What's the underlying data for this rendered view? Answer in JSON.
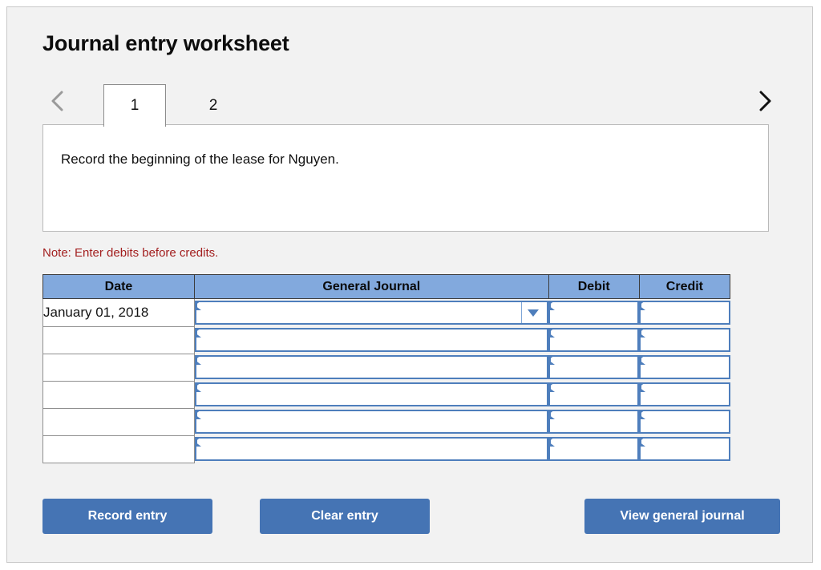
{
  "title": "Journal entry worksheet",
  "navigation": {
    "prev_icon": "chevron-left-icon",
    "next_icon": "chevron-right-icon",
    "tabs": [
      {
        "label": "1",
        "active": true
      },
      {
        "label": "2",
        "active": false
      }
    ]
  },
  "instruction": {
    "text": "Record the beginning of the lease for Nguyen."
  },
  "note": {
    "text": "Note: Enter debits before credits."
  },
  "table": {
    "headers": {
      "date": "Date",
      "general_journal": "General Journal",
      "debit": "Debit",
      "credit": "Credit"
    },
    "rows": [
      {
        "date": "January 01, 2018",
        "general_journal": "",
        "debit": "",
        "credit": "",
        "has_dropdown": true
      },
      {
        "date": "",
        "general_journal": "",
        "debit": "",
        "credit": "",
        "has_dropdown": false
      },
      {
        "date": "",
        "general_journal": "",
        "debit": "",
        "credit": "",
        "has_dropdown": false
      },
      {
        "date": "",
        "general_journal": "",
        "debit": "",
        "credit": "",
        "has_dropdown": false
      },
      {
        "date": "",
        "general_journal": "",
        "debit": "",
        "credit": "",
        "has_dropdown": false
      },
      {
        "date": "",
        "general_journal": "",
        "debit": "",
        "credit": "",
        "has_dropdown": false
      }
    ]
  },
  "buttons": {
    "record": "Record entry",
    "clear": "Clear entry",
    "view": "View general journal"
  },
  "colors": {
    "header_blue": "#82a9dd",
    "button_blue": "#4574b4",
    "entry_border_blue": "#4e7ebc",
    "note_red": "#a32020",
    "panel_background": "#f2f2f2"
  }
}
